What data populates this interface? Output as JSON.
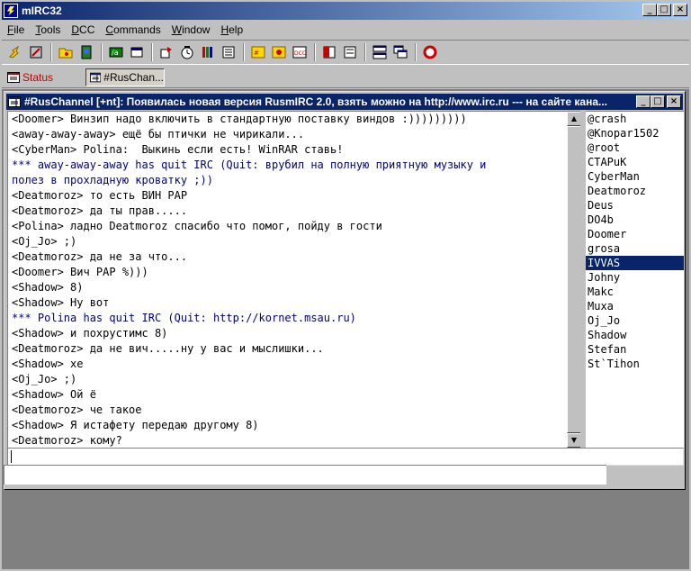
{
  "app": {
    "title": "mIRC32",
    "controls": {
      "minimize": "_",
      "maximize": "□",
      "close": "×"
    }
  },
  "menu": [
    "File",
    "Tools",
    "DCC",
    "Commands",
    "Window",
    "Help"
  ],
  "toolbar_icons": [
    "connect-icon",
    "options-icon",
    "channels-folder-icon",
    "address-book-icon",
    "url-icon",
    "notify-icon",
    "dcc-send-icon",
    "dcc-chat-icon",
    "dcc-options-icon",
    "about-icon",
    "channel-list-icon",
    "log-icon",
    "dcc-icon",
    "channel-central-icon",
    "chat-list-icon",
    "tile-icon",
    "cascade-icon",
    "help-icon"
  ],
  "switchbar": {
    "tabs": [
      {
        "label": "Status",
        "active": false
      },
      {
        "label": "#RusChan...",
        "active": true
      }
    ]
  },
  "channel": {
    "title": "#RusChannel [+nt]: Появилась новая версия RusmIRC 2.0, взять можно на http://www.irc.ru --- на сайте кана...",
    "lines": [
      {
        "text": "<Doomer> Винзип надо включить в стандартную поставку виндов :)))))))))",
        "type": "msg"
      },
      {
        "text": "<away-away-away> ещё бы птички не чирикали...",
        "type": "msg"
      },
      {
        "text": "<CyberMan> Polina:  Выкинь если есть! WinRAR ставь!",
        "type": "msg"
      },
      {
        "text": "*** away-away-away has quit IRC (Quit: врубил на полную приятную музыку и",
        "type": "quit"
      },
      {
        "text": "полез в прохладную кроватку ;))",
        "type": "quit"
      },
      {
        "text": "<Deatmoroz> то есть ВИН РАР",
        "type": "msg"
      },
      {
        "text": "<Deatmoroz> да ты прав.....",
        "type": "msg"
      },
      {
        "text": "<Polina> ладно Deatmoroz спасибо что помог, пойду в гости",
        "type": "msg"
      },
      {
        "text": "<Oj_Jo> ;)",
        "type": "msg"
      },
      {
        "text": "<Deatmoroz> да не за что...",
        "type": "msg"
      },
      {
        "text": "<Doomer> Вич РАР %)))",
        "type": "msg"
      },
      {
        "text": "<Shadow> 8)",
        "type": "msg"
      },
      {
        "text": "<Shadow> Ну вот",
        "type": "msg"
      },
      {
        "text": "*** Polina has quit IRC (Quit: http://kornet.msau.ru)",
        "type": "quit"
      },
      {
        "text": "<Shadow> и похрустимс 8)",
        "type": "msg"
      },
      {
        "text": "<Deatmoroz> да не вич.....ну у вас и мыслишки...",
        "type": "msg"
      },
      {
        "text": "<Shadow> хе",
        "type": "msg"
      },
      {
        "text": "<Oj_Jo> ;)",
        "type": "msg"
      },
      {
        "text": "<Shadow> Ой ё",
        "type": "msg"
      },
      {
        "text": "<Deatmoroz> че такое",
        "type": "msg"
      },
      {
        "text": "<Shadow> Я истафету передаю другому 8)",
        "type": "msg"
      },
      {
        "text": "<Deatmoroz> кому?",
        "type": "msg"
      }
    ],
    "nicks": [
      {
        "name": "@crash",
        "selected": false
      },
      {
        "name": "@Knopar1502",
        "selected": false
      },
      {
        "name": "@root",
        "selected": false
      },
      {
        "name": "CTAPuK",
        "selected": false
      },
      {
        "name": "CyberMan",
        "selected": false
      },
      {
        "name": "Deatmoroz",
        "selected": false
      },
      {
        "name": "Deus",
        "selected": false
      },
      {
        "name": "DO4b",
        "selected": false
      },
      {
        "name": "Doomer",
        "selected": false
      },
      {
        "name": "grosa",
        "selected": false
      },
      {
        "name": "IVVAS",
        "selected": true
      },
      {
        "name": "Johny",
        "selected": false
      },
      {
        "name": "Makc",
        "selected": false
      },
      {
        "name": "Muxa",
        "selected": false
      },
      {
        "name": "Oj_Jo",
        "selected": false
      },
      {
        "name": "Shadow",
        "selected": false
      },
      {
        "name": "Stefan",
        "selected": false
      },
      {
        "name": "St`Tihon",
        "selected": false
      }
    ],
    "input_value": ""
  },
  "colors": {
    "title_active": "#0a246a",
    "quit_message": "#00007f",
    "status_tab_text": "#c00000"
  }
}
